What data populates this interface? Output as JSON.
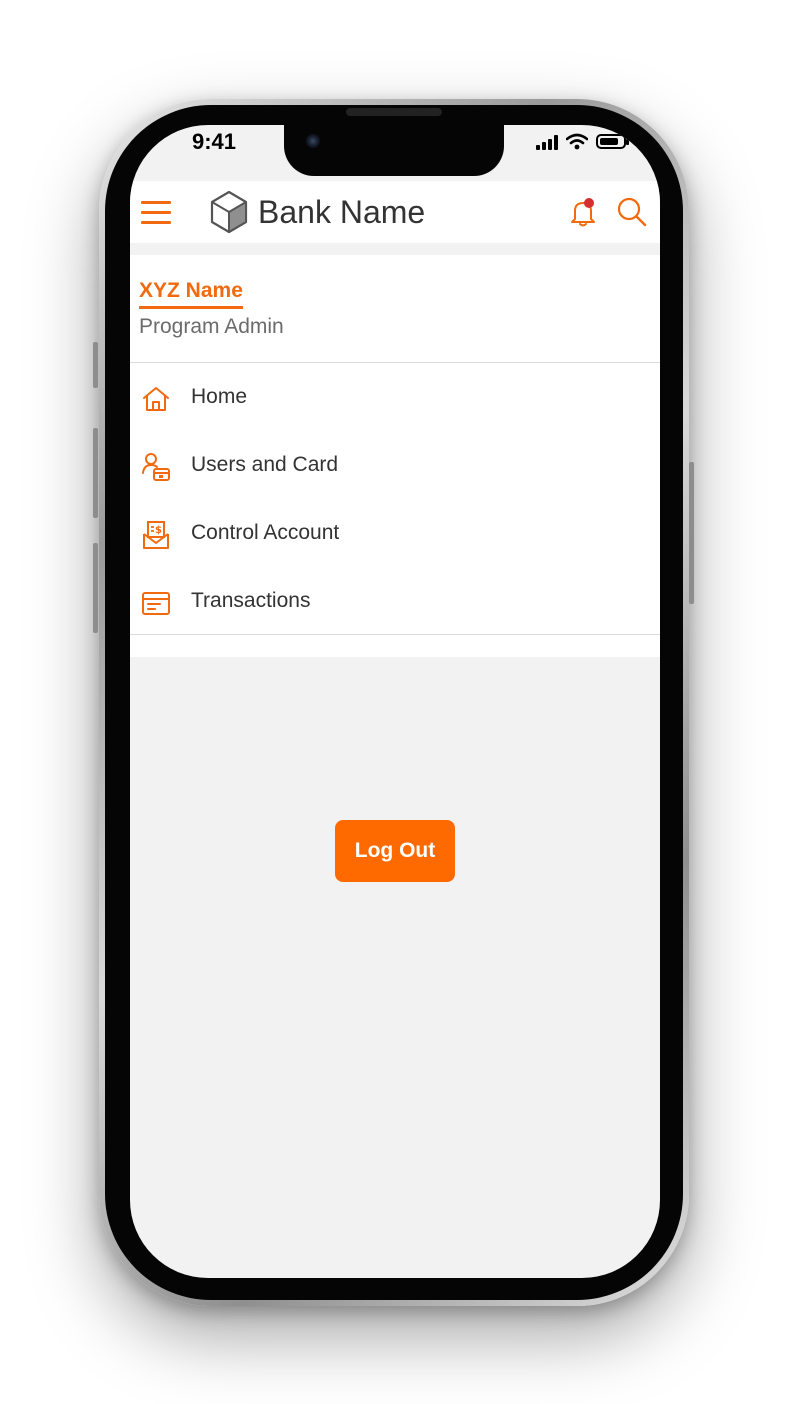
{
  "status_bar": {
    "time": "9:41"
  },
  "header": {
    "title": "Bank Name"
  },
  "user": {
    "name": "XYZ Name",
    "role": "Program Admin"
  },
  "menu": {
    "items": [
      {
        "label": "Home",
        "icon": "home-icon"
      },
      {
        "label": "Users and Card",
        "icon": "user-card-icon"
      },
      {
        "label": "Control Account",
        "icon": "invoice-envelope-icon"
      },
      {
        "label": "Transactions",
        "icon": "transactions-icon"
      }
    ]
  },
  "logout": {
    "label": "Log Out"
  },
  "colors": {
    "accent": "#F26A0F",
    "button": "#FF6A00",
    "notification_dot": "#D32F2F",
    "background": "#F2F2F2"
  }
}
